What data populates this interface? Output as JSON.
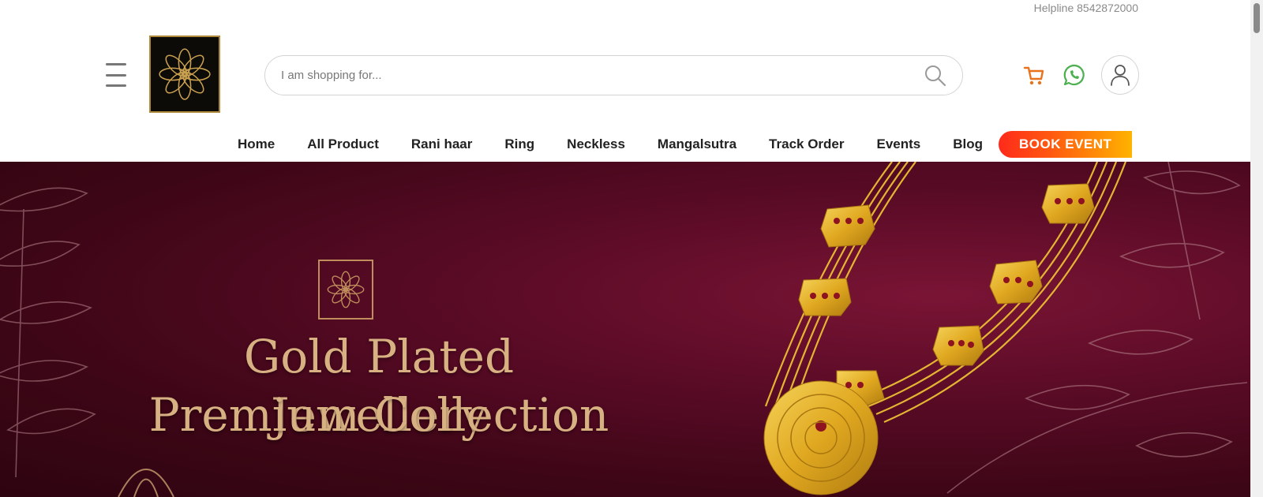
{
  "header": {
    "helpline": "Helpline 8542872000",
    "search": {
      "placeholder": "I am shopping for..."
    }
  },
  "nav": {
    "items": [
      "Home",
      "All Product",
      "Rani haar",
      "Ring",
      "Neckless",
      "Mangalsutra",
      "Track Order",
      "Events",
      "Blog"
    ],
    "cta": "BOOK EVENT"
  },
  "banner": {
    "title_line1": "Gold Plated Jewellery",
    "title_line2": "Premium Collection"
  },
  "colors": {
    "brand_gold": "#b08a3c",
    "banner_maroon": "#5a0b26",
    "cart_orange": "#e8731c",
    "whatsapp_green": "#4caf50",
    "cta_gradient": [
      "#ff2a1a",
      "#ffb300"
    ]
  },
  "icons": {
    "menu": "hamburger-icon",
    "search": "search-icon",
    "cart": "cart-icon",
    "whatsapp": "whatsapp-icon",
    "account": "user-icon"
  }
}
